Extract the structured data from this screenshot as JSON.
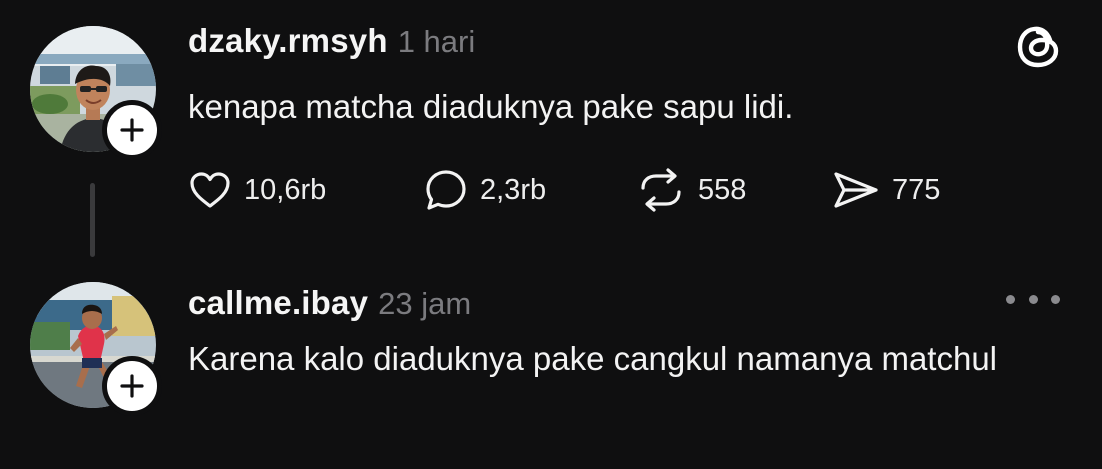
{
  "post": {
    "username": "dzaky.rmsyh",
    "timestamp": "1 hari",
    "text": "kenapa matcha diaduknya pake sapu lidi.",
    "stats": {
      "likes": "10,6rb",
      "replies": "2,3rb",
      "reposts": "558",
      "shares": "775"
    },
    "brand_icon": "threads-logo-icon"
  },
  "reply": {
    "username": "callme.ibay",
    "timestamp": "23 jam",
    "text": "Karena kalo diaduknya pake cangkul namanya matchul",
    "menu_icon": "more-options-icon"
  },
  "colors": {
    "background": "#0f0f10",
    "text": "#f3f3f3",
    "muted": "#7b7b7f",
    "thread_line": "#3a3a3c"
  }
}
